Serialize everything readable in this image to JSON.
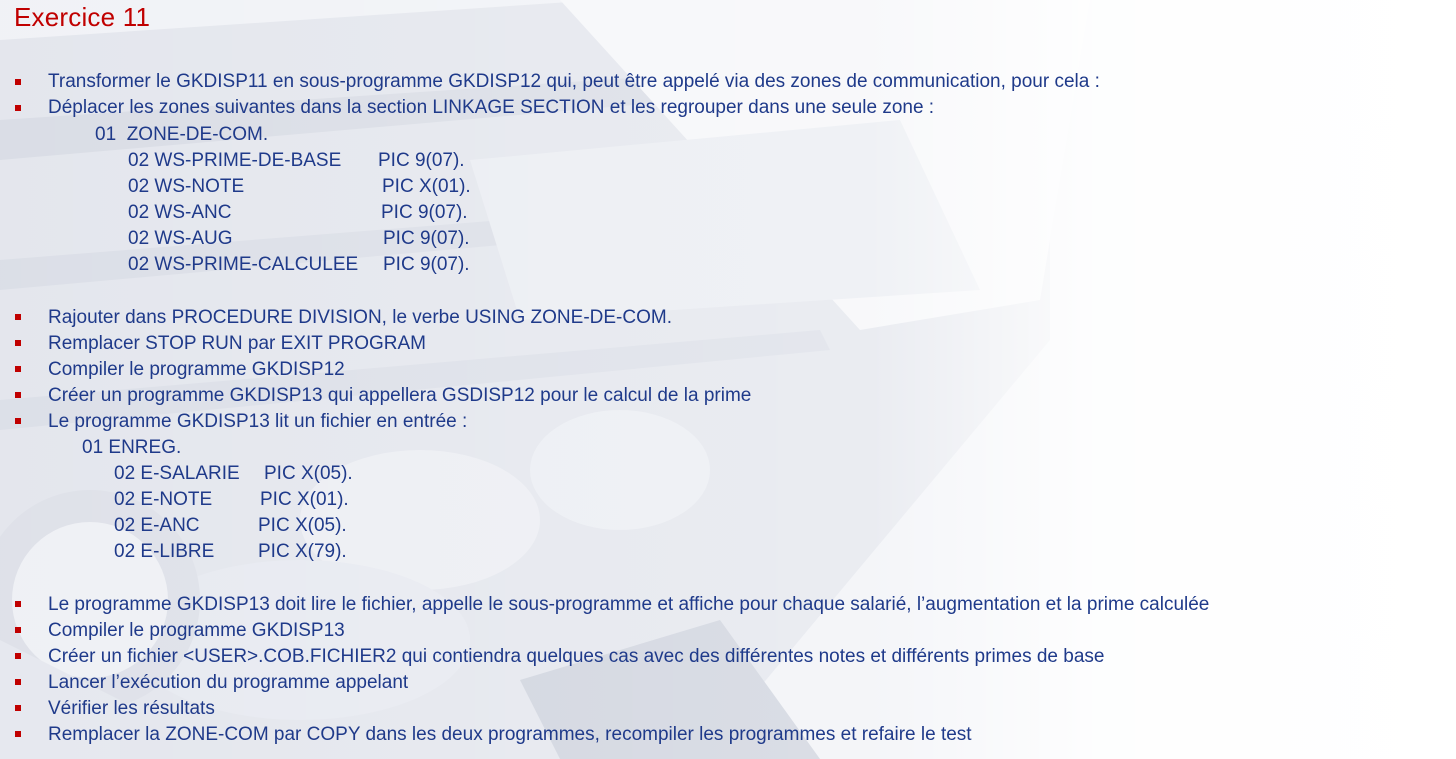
{
  "slide": {
    "title": "Exercice 11"
  },
  "bullets_top": [
    "Transformer le GKDISP11 en sous-programme GKDISP12 qui, peut être appelé via des zones de communication, pour cela :",
    "Déplacer les zones  suivantes dans la section  LINKAGE SECTION et les regrouper dans une seule zone :"
  ],
  "zone_de_com": {
    "header": "01  ZONE-DE-COM.",
    "fields": [
      {
        "name": "02  WS-PRIME-DE-BASE",
        "pic": "PIC 9(07)."
      },
      {
        "name": "02  WS-NOTE",
        "pic": "PIC X(01)."
      },
      {
        "name": "02  WS-ANC",
        "pic": "PIC 9(07)."
      },
      {
        "name": "02  WS-AUG",
        "pic": "PIC 9(07)."
      },
      {
        "name": "02  WS-PRIME-CALCULEE",
        "pic": "PIC 9(07)."
      }
    ]
  },
  "bullets_middle": [
    "Rajouter dans PROCEDURE DIVISION, le verbe USING  ZONE-DE-COM.",
    "Remplacer STOP RUN par EXIT PROGRAM",
    "Compiler le programme GKDISP12",
    "Créer un programme GKDISP13 qui appellera GSDISP12 pour le calcul de la prime",
    "Le programme GKDISP13 lit un fichier en entrée :"
  ],
  "enreg": {
    "header": "01 ENREG.",
    "fields": [
      {
        "name": "02 E-SALARIE",
        "pic": "PIC X(05)."
      },
      {
        "name": "02 E-NOTE",
        "pic": "PIC X(01)."
      },
      {
        "name": "02 E-ANC",
        "pic": "PIC X(05)."
      },
      {
        "name": "02 E-LIBRE",
        "pic": "PIC X(79)."
      }
    ]
  },
  "bullets_bottom": [
    "Le programme GKDISP13 doit lire le fichier, appelle le sous-programme et affiche pour chaque salarié, l’augmentation et la prime calculée",
    "Compiler le programme GKDISP13",
    "Créer un fichier <USER>.COB.FICHIER2 qui contiendra quelques cas avec des différentes notes et différents primes de base",
    "Lancer l’exécution du programme appelant",
    "Vérifier les résultats",
    "Remplacer la ZONE-COM par COPY dans les deux programmes, recompiler les programmes et refaire le test"
  ],
  "colors": {
    "title": "#c00000",
    "text": "#1f3a8a",
    "bullet": "#c00000"
  }
}
